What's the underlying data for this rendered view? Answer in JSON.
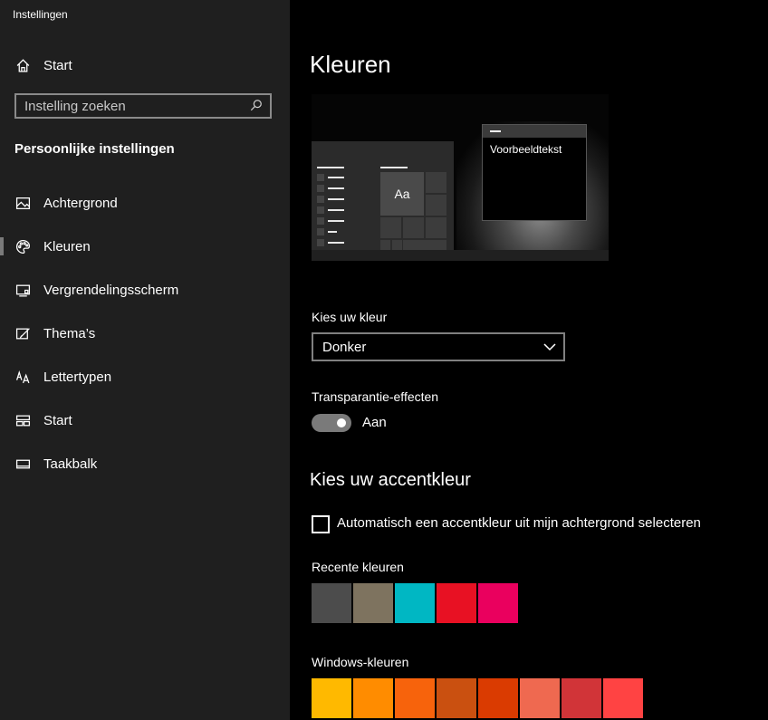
{
  "app": {
    "title": "Instellingen"
  },
  "sidebar": {
    "home_label": "Start",
    "search_placeholder": "Instelling zoeken",
    "section_title": "Persoonlijke instellingen",
    "items": [
      {
        "label": "Achtergrond",
        "icon": "image-icon"
      },
      {
        "label": "Kleuren",
        "icon": "palette-icon",
        "selected": true
      },
      {
        "label": "Vergrendelingsscherm",
        "icon": "lockscreen-icon"
      },
      {
        "label": "Thema’s",
        "icon": "themes-icon"
      },
      {
        "label": "Lettertypen",
        "icon": "fonts-icon"
      },
      {
        "label": "Start",
        "icon": "start-icon"
      },
      {
        "label": "Taakbalk",
        "icon": "taskbar-icon"
      }
    ]
  },
  "main": {
    "title": "Kleuren",
    "preview": {
      "tile_label": "Aa",
      "window_text": "Voorbeeldtekst"
    },
    "choose_color": {
      "label": "Kies uw kleur",
      "selected": "Donker"
    },
    "transparency": {
      "label": "Transparantie-effecten",
      "state": "Aan",
      "on": true
    },
    "accent": {
      "title": "Kies uw accentkleur",
      "auto_label": "Automatisch een accentkleur uit mijn achtergrond selecteren",
      "auto_checked": false,
      "recent_label": "Recente kleuren",
      "recent_colors": [
        "#4c4c4c",
        "#7e735f",
        "#00b7c3",
        "#e81123",
        "#ea005e"
      ],
      "windows_label": "Windows-kleuren",
      "windows_colors": [
        "#ffb900",
        "#ff8c00",
        "#f7630c",
        "#ca5010",
        "#da3b01",
        "#ef6950",
        "#d13438",
        "#ff4343"
      ]
    }
  }
}
